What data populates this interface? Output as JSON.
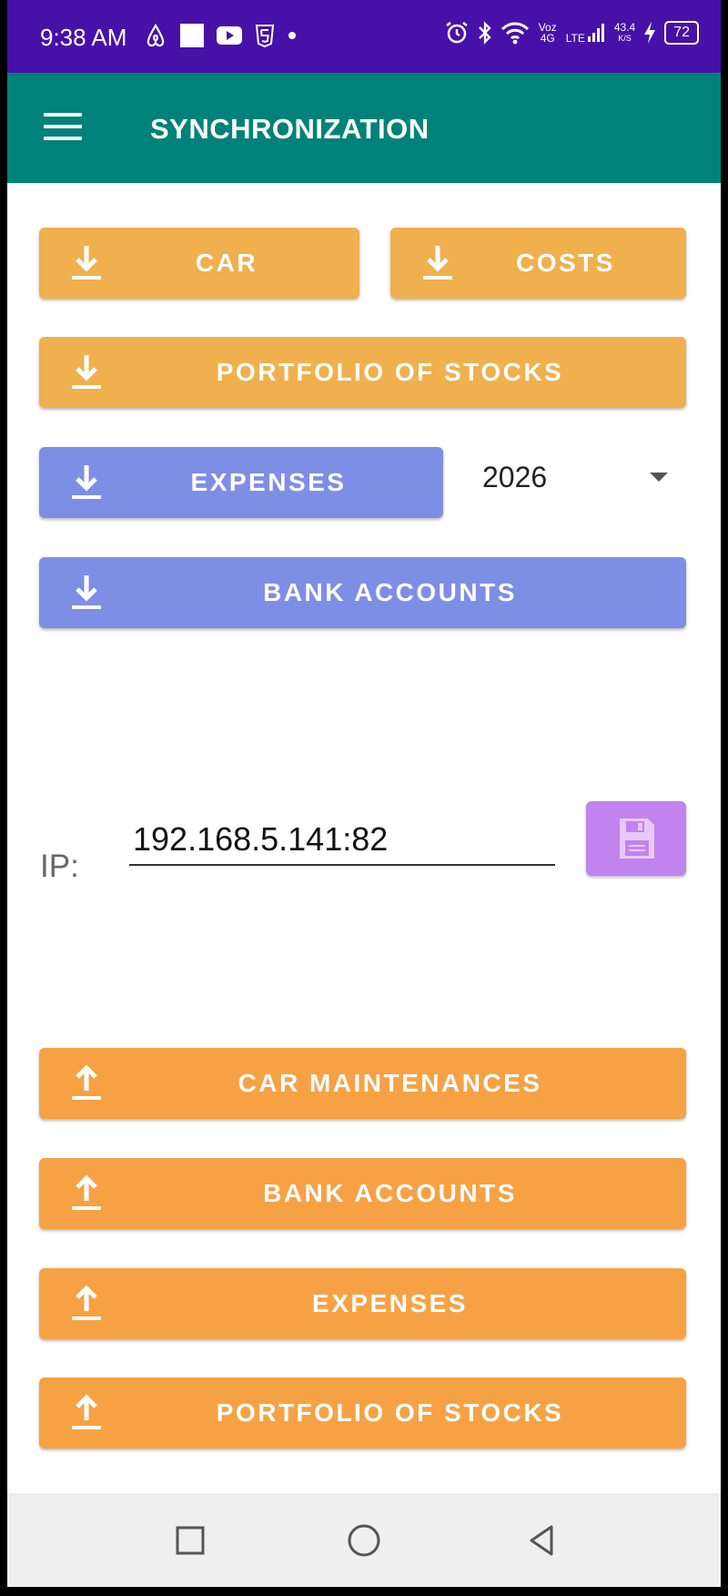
{
  "status_bar": {
    "time": "9:38 AM",
    "net_type": "Voz 4G",
    "lte": "LTE",
    "speed_value": "43.4",
    "speed_unit": "K/S",
    "battery": "72"
  },
  "app_bar": {
    "title": "SYNCHRONIZATION"
  },
  "download": {
    "car": "CAR",
    "costs": "COSTS",
    "portfolio": "PORTFOLIO OF STOCKS",
    "expenses": "EXPENSES",
    "bank_accounts": "BANK ACCOUNTS"
  },
  "year_select": {
    "value": "2026"
  },
  "ip": {
    "label": "IP:",
    "value": "192.168.5.141:82"
  },
  "upload": {
    "car_maintenances": "CAR MAINTENANCES",
    "bank_accounts": "BANK ACCOUNTS",
    "expenses": "EXPENSES",
    "portfolio": "PORTFOLIO OF STOCKS"
  },
  "colors": {
    "status_bar": "#4711a8",
    "app_bar": "#00827a",
    "download_orange": "#f0b04d",
    "download_blue": "#7d8fe5",
    "upload_orange": "#f6a244",
    "save_purple": "#c183ee"
  },
  "icons": {
    "download": "download-icon",
    "upload": "upload-icon",
    "save": "floppy-disk-icon",
    "menu": "hamburger-menu-icon"
  }
}
